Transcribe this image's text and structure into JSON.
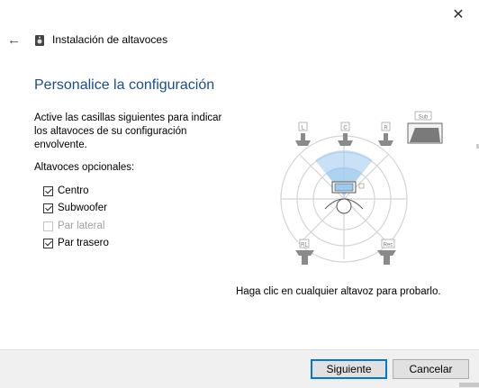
{
  "window": {
    "close_glyph": "✕",
    "back_glyph": "←",
    "title": "Instalación de altavoces"
  },
  "page": {
    "heading": "Personalice la configuración",
    "instructions": "Active las casillas siguientes para indicar los altavoces de su configuración envolvente.",
    "optional_label": "Altavoces opcionales:"
  },
  "options": [
    {
      "label": "Centro",
      "checked": true,
      "enabled": true
    },
    {
      "label": "Subwoofer",
      "checked": true,
      "enabled": true
    },
    {
      "label": "Par lateral",
      "checked": false,
      "enabled": false
    },
    {
      "label": "Par trasero",
      "checked": true,
      "enabled": true
    }
  ],
  "diagram": {
    "speaker_labels": {
      "front_left": "L",
      "center": "C",
      "front_right": "R",
      "subwoofer": "Sub",
      "rear_left": "RL",
      "rear_right": "Rec"
    },
    "accent": "#9cc9ee"
  },
  "hint": "Haga clic en cualquier altavoz para probarlo.",
  "buttons": {
    "next": "Siguiente",
    "cancel": "Cancelar"
  },
  "colors": {
    "heading": "#1a4d8c",
    "primary_border": "#0078d7",
    "footer_bg": "#f0f0f0"
  }
}
